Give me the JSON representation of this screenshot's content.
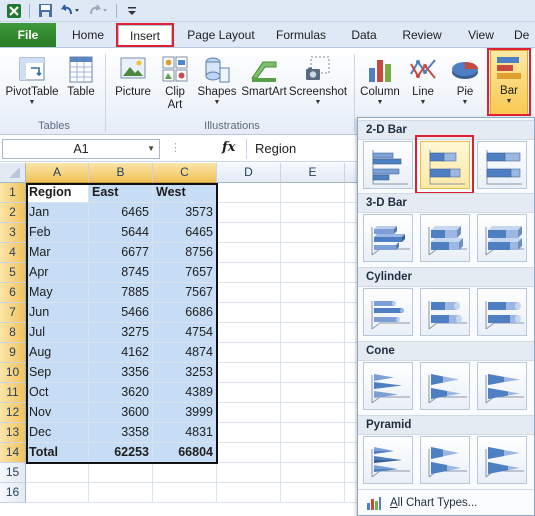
{
  "tabs": {
    "file": "File",
    "home": "Home",
    "insert": "Insert",
    "page_layout": "Page Layout",
    "formulas": "Formulas",
    "data": "Data",
    "review": "Review",
    "view": "View",
    "developer_partial": "De"
  },
  "ribbon": {
    "pivottable": "PivotTable",
    "table": "Table",
    "picture": "Picture",
    "clipart_line1": "Clip",
    "clipart_line2": "Art",
    "shapes": "Shapes",
    "smartart": "SmartArt",
    "screenshot": "Screenshot",
    "column": "Column",
    "line": "Line",
    "pie": "Pie",
    "bar": "Bar",
    "group_tables": "Tables",
    "group_illustrations": "Illustrations"
  },
  "formula_bar": {
    "name_box": "A1",
    "fx": "fx",
    "content": "Region"
  },
  "sheet": {
    "columns": [
      "A",
      "B",
      "C",
      "D",
      "E"
    ],
    "rows": [
      "1",
      "2",
      "3",
      "4",
      "5",
      "6",
      "7",
      "8",
      "9",
      "10",
      "11",
      "12",
      "13",
      "14",
      "15",
      "16"
    ],
    "header": [
      "Region",
      "East",
      "West"
    ],
    "data": [
      [
        "Jan",
        "6465",
        "3573"
      ],
      [
        "Feb",
        "5644",
        "6465"
      ],
      [
        "Mar",
        "6677",
        "8756"
      ],
      [
        "Apr",
        "8745",
        "7657"
      ],
      [
        "May",
        "7885",
        "7567"
      ],
      [
        "Jun",
        "5466",
        "6686"
      ],
      [
        "Jul",
        "3275",
        "4754"
      ],
      [
        "Aug",
        "4162",
        "4874"
      ],
      [
        "Sep",
        "3356",
        "3253"
      ],
      [
        "Oct",
        "3620",
        "4389"
      ],
      [
        "Nov",
        "3600",
        "3999"
      ],
      [
        "Dec",
        "3358",
        "4831"
      ]
    ],
    "total": [
      "Total",
      "62253",
      "66804"
    ]
  },
  "gallery": {
    "sections": [
      "2-D Bar",
      "3-D Bar",
      "Cylinder",
      "Cone",
      "Pyramid"
    ],
    "footer": "All Chart Types..."
  },
  "colors": {
    "selection_fill": "#c7ddf5",
    "highlight_red": "#e02030",
    "file_tab_green": "#2e8a2a",
    "header_selected": "#f1c15a"
  }
}
